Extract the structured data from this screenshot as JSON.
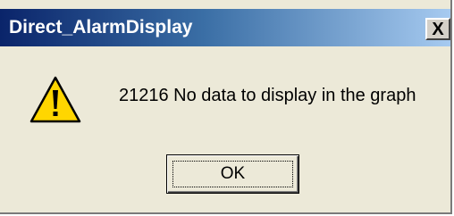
{
  "window": {
    "title": "Direct_AlarmDisplay",
    "close_glyph": "X",
    "close_icon": "close-icon"
  },
  "message": {
    "icon": "warning-icon",
    "text": "21216 No data to display in the graph"
  },
  "buttons": {
    "ok_label": "OK"
  },
  "colors": {
    "titlebar_start": "#0a246a",
    "titlebar_end": "#a6caf0",
    "dialog_bg": "#ece9d8",
    "warning_fill": "#ffd600"
  }
}
